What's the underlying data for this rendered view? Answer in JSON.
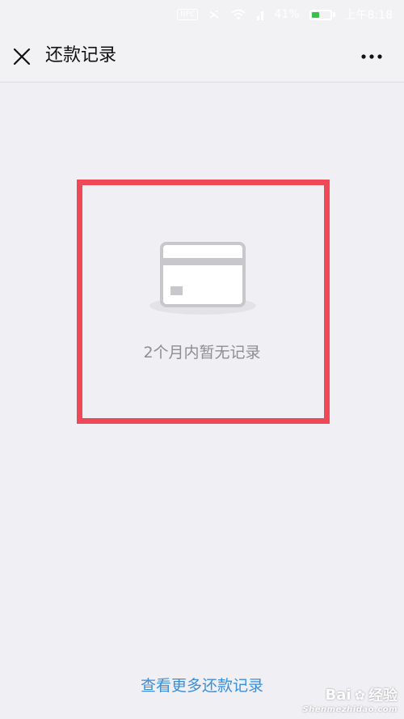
{
  "status_bar": {
    "nfc_label": "NFC",
    "battery_percent": "41%",
    "battery_level": 0.41,
    "time": "上午8:18"
  },
  "nav": {
    "title": "还款记录",
    "close_icon": "close-icon",
    "more_icon": "more-horizontal-icon"
  },
  "empty_state": {
    "icon": "credit-card-icon",
    "message": "2个月内暂无记录"
  },
  "footer": {
    "more_records_link": "查看更多还款记录"
  },
  "watermark": {
    "brand": "Bai",
    "brand_suffix": "经验",
    "site": "Shenmezhidao.com"
  },
  "colors": {
    "background": "#efeff4",
    "highlight": "#ef4957",
    "link": "#3b8fd9",
    "muted_text": "#8d8d92"
  }
}
